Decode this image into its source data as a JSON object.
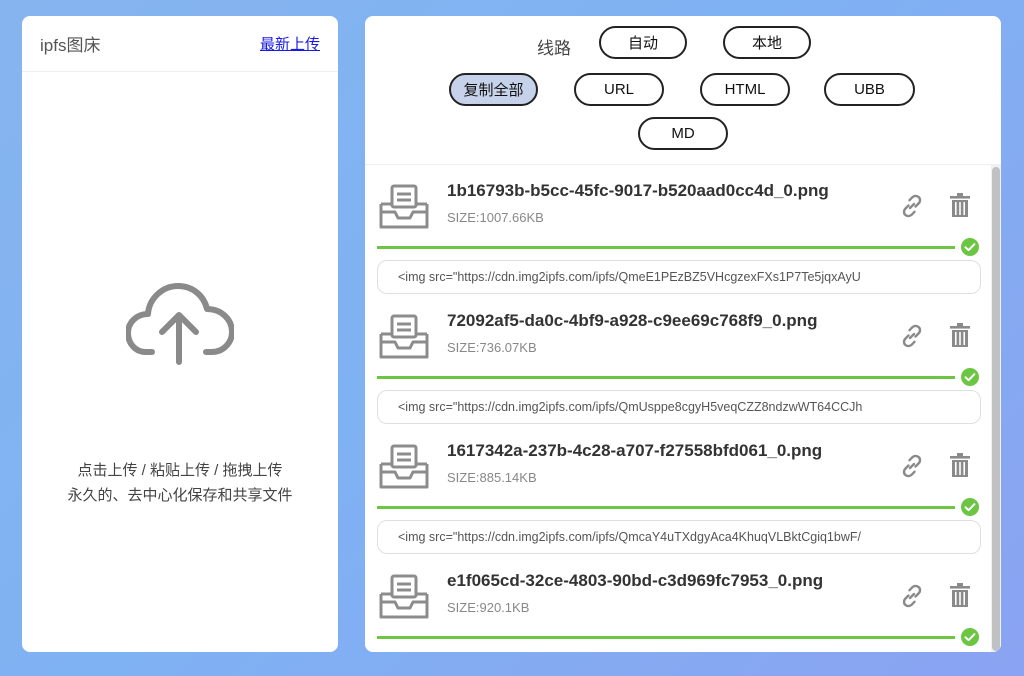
{
  "left": {
    "title": "ipfs图床",
    "latest_link": "最新上传",
    "upload_line1": "点击上传 / 粘贴上传 / 拖拽上传",
    "upload_line2": "永久的、去中心化保存和共享文件"
  },
  "route": {
    "label": "线路",
    "options": [
      "自动",
      "本地"
    ]
  },
  "formats": {
    "copy_all": "复制全部",
    "buttons": [
      "URL",
      "HTML",
      "UBB",
      "MD"
    ]
  },
  "files": [
    {
      "name": "1b16793b-b5cc-45fc-9017-b520aad0cc4d_0.png",
      "size": "SIZE:1007.66KB",
      "progress": 1.0,
      "code": "<img src=\"https://cdn.img2ipfs.com/ipfs/QmeE1PEzBZ5VHcgzexFXs1P7Te5jqxAyU"
    },
    {
      "name": "72092af5-da0c-4bf9-a928-c9ee69c768f9_0.png",
      "size": "SIZE:736.07KB",
      "progress": 1.0,
      "code": "<img src=\"https://cdn.img2ipfs.com/ipfs/QmUsppe8cgyH5veqCZZ8ndzwWT64CCJh"
    },
    {
      "name": "1617342a-237b-4c28-a707-f27558bfd061_0.png",
      "size": "SIZE:885.14KB",
      "progress": 1.0,
      "code": "<img src=\"https://cdn.img2ipfs.com/ipfs/QmcaY4uTXdgyAca4KhuqVLBktCgiq1bwF/"
    },
    {
      "name": "e1f065cd-32ce-4803-90bd-c3d969fc7953_0.png",
      "size": "SIZE:920.1KB",
      "progress": 1.0,
      "code": ""
    }
  ],
  "icons": {
    "upload": "cloud-upload-icon",
    "file": "inbox-icon",
    "copy_link": "link-icon",
    "delete": "trash-icon",
    "done": "check-circle-icon"
  },
  "colors": {
    "progress": "#6cc644",
    "active_pill": "#c6d2ea",
    "link": "#1a1ae6"
  }
}
